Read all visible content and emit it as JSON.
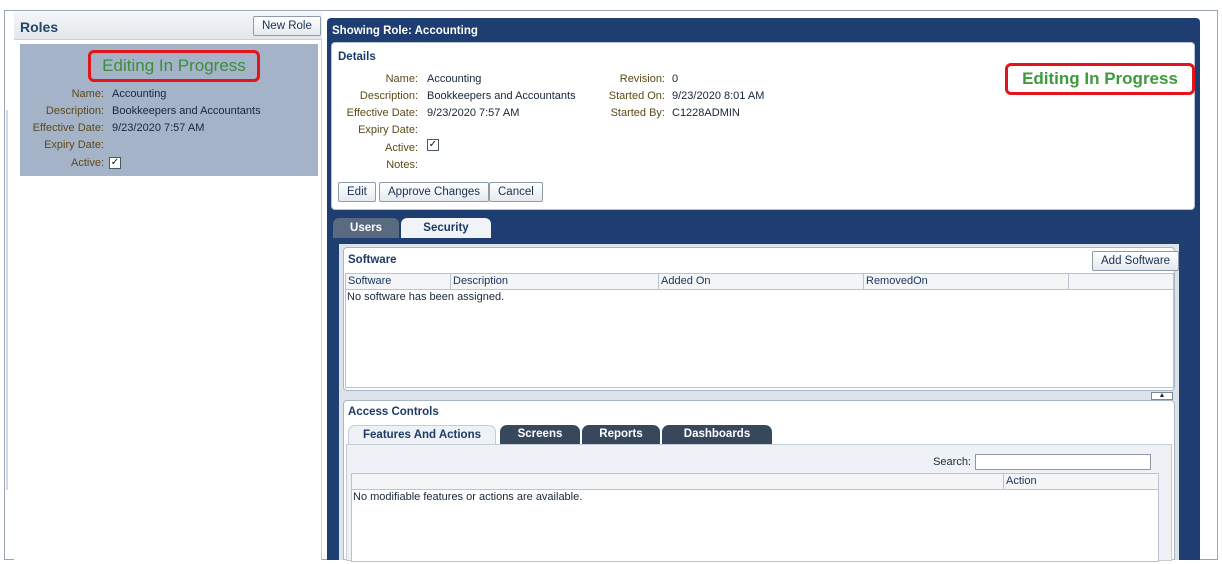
{
  "roles": {
    "title": "Roles",
    "new_role_label": "New Role",
    "selected": {
      "status": "Editing In Progress",
      "name_label": "Name:",
      "name": "Accounting",
      "description_label": "Description:",
      "description": "Bookkeepers and Accountants",
      "effective_label": "Effective Date:",
      "effective": "9/23/2020 7:57 AM",
      "expiry_label": "Expiry Date:",
      "expiry": "",
      "active_label": "Active:",
      "active": "✓"
    }
  },
  "detail": {
    "heading": "Showing Role: Accounting",
    "section": "Details",
    "status": "Editing In Progress",
    "fields": {
      "name_label": "Name:",
      "name": "Accounting",
      "description_label": "Description:",
      "description": "Bookkeepers and Accountants",
      "effective_label": "Effective Date:",
      "effective": "9/23/2020 7:57 AM",
      "expiry_label": "Expiry Date:",
      "expiry": "",
      "active_label": "Active:",
      "active": "✓",
      "notes_label": "Notes:",
      "notes": "",
      "revision_label": "Revision:",
      "revision": "0",
      "started_on_label": "Started On:",
      "started_on": "9/23/2020 8:01 AM",
      "started_by_label": "Started By:",
      "started_by": "C1228ADMIN"
    },
    "buttons": {
      "edit": "Edit",
      "approve": "Approve Changes",
      "cancel": "Cancel"
    }
  },
  "tabs": {
    "users": "Users",
    "security": "Security"
  },
  "software": {
    "title": "Software",
    "add_label": "Add Software",
    "columns": [
      "Software",
      "Description",
      "Added On",
      "RemovedOn",
      ""
    ],
    "empty": "No software has been assigned."
  },
  "access": {
    "title": "Access Controls",
    "tabs": [
      "Features And Actions",
      "Screens",
      "Reports",
      "Dashboards"
    ],
    "search_label": "Search:",
    "search_value": "",
    "columns": [
      "",
      "Action"
    ],
    "empty": "No modifiable features or actions are available."
  }
}
